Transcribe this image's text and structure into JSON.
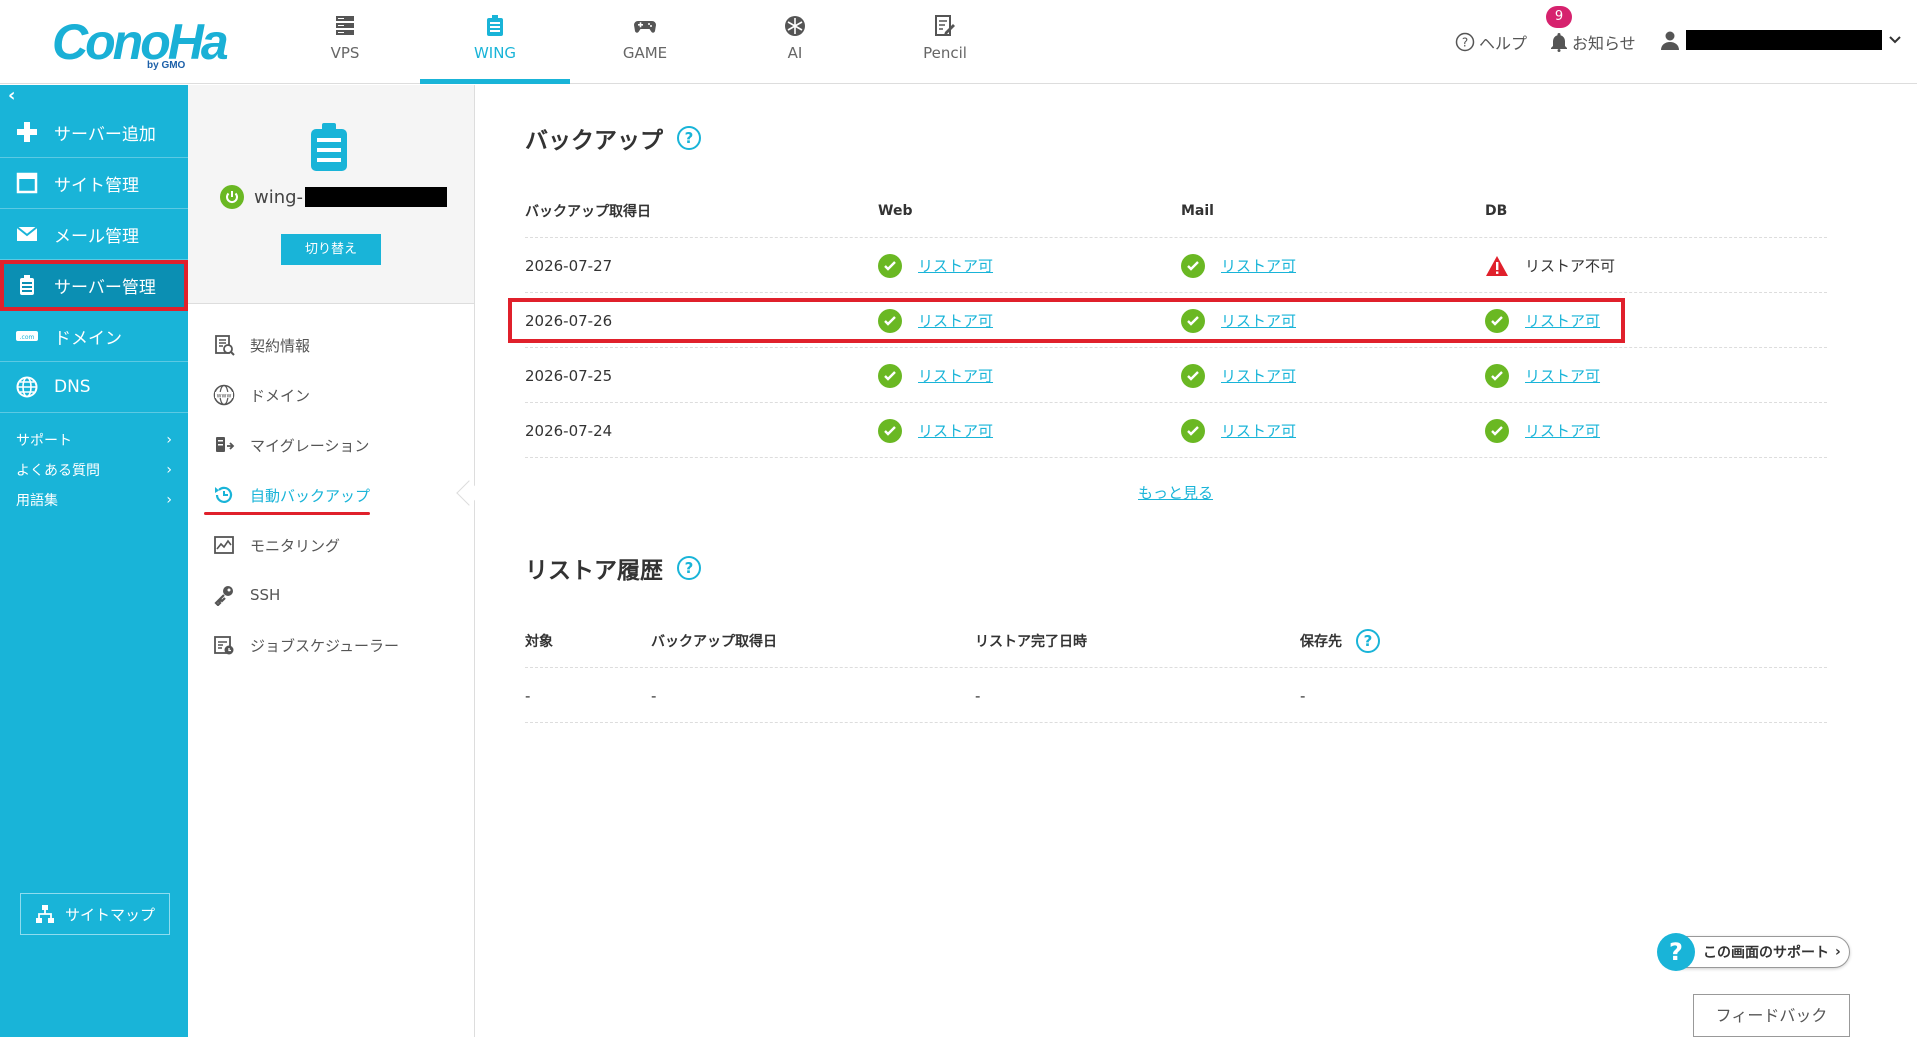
{
  "header": {
    "logo_text": "ConoHa",
    "logo_by": "by GMO",
    "nav": [
      {
        "label": "VPS",
        "icon": "server-icon"
      },
      {
        "label": "WING",
        "icon": "wing-icon"
      },
      {
        "label": "GAME",
        "icon": "gamepad-icon"
      },
      {
        "label": "AI",
        "icon": "ai-icon"
      },
      {
        "label": "Pencil",
        "icon": "pencil-icon"
      }
    ],
    "help_label": "ヘルプ",
    "notice_label": "お知らせ",
    "notice_count": "9"
  },
  "sidebar": {
    "collapse_glyph": "‹",
    "items": [
      {
        "label": "サーバー追加"
      },
      {
        "label": "サイト管理"
      },
      {
        "label": "メール管理"
      },
      {
        "label": "サーバー管理"
      },
      {
        "label": "ドメイン"
      },
      {
        "label": "DNS"
      }
    ],
    "sub": [
      {
        "label": "サポート"
      },
      {
        "label": "よくある質問"
      },
      {
        "label": "用語集"
      }
    ],
    "sitemap_label": "サイトマップ"
  },
  "server_panel": {
    "name_prefix": "wing-",
    "switch_label": "切り替え",
    "menu": [
      {
        "label": "契約情報"
      },
      {
        "label": "ドメイン"
      },
      {
        "label": "マイグレーション"
      },
      {
        "label": "自動バックアップ"
      },
      {
        "label": "モニタリング"
      },
      {
        "label": "SSH"
      },
      {
        "label": "ジョブスケジューラー"
      }
    ]
  },
  "backup": {
    "title": "バックアップ",
    "columns": [
      "バックアップ取得日",
      "Web",
      "Mail",
      "DB"
    ],
    "rows": [
      {
        "date": "2026-07-27",
        "web": "リストア可",
        "mail": "リストア可",
        "db": "リストア不可",
        "db_ok": false
      },
      {
        "date": "2026-07-26",
        "web": "リストア可",
        "mail": "リストア可",
        "db": "リストア可",
        "db_ok": true
      },
      {
        "date": "2026-07-25",
        "web": "リストア可",
        "mail": "リストア可",
        "db": "リストア可",
        "db_ok": true
      },
      {
        "date": "2026-07-24",
        "web": "リストア可",
        "mail": "リストア可",
        "db": "リストア可",
        "db_ok": true
      }
    ],
    "more_label": "もっと見る"
  },
  "restore_history": {
    "title": "リストア履歴",
    "columns": [
      "対象",
      "バックアップ取得日",
      "リストア完了日時",
      "保存先"
    ],
    "rows": [
      [
        "-",
        "-",
        "-",
        "-"
      ]
    ]
  },
  "support_label": "この画面のサポート",
  "feedback_label": "フィードバック",
  "colors": {
    "accent": "#19b4d8",
    "ok": "#6ab823",
    "warn": "#e0202b",
    "badge": "#d6226e"
  }
}
